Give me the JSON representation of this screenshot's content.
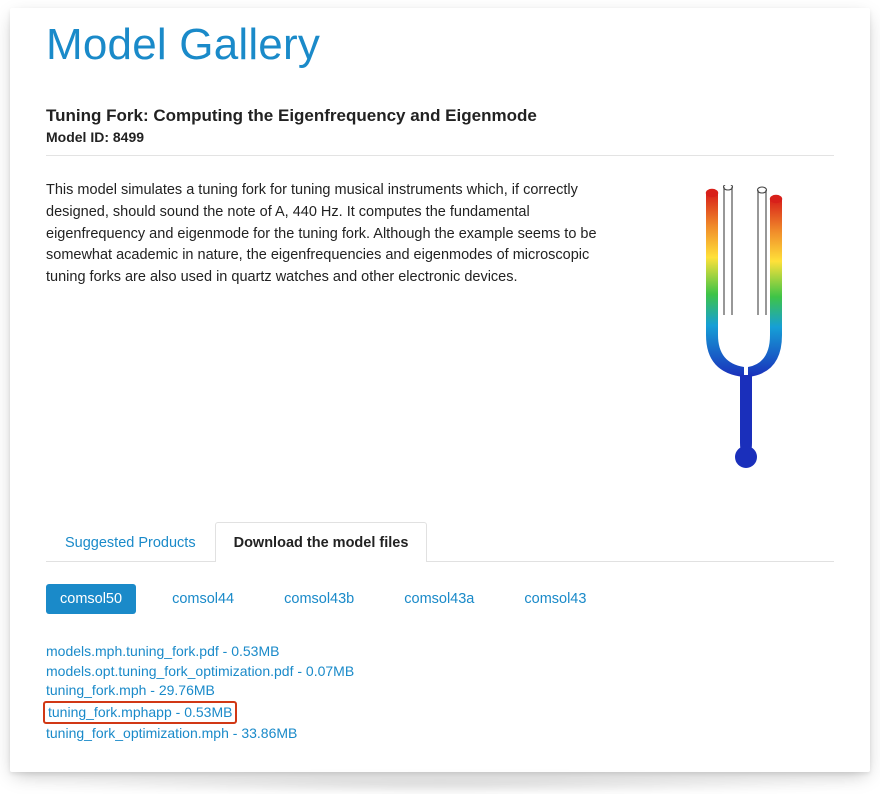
{
  "header": {
    "title": "Model Gallery"
  },
  "model": {
    "title": "Tuning Fork: Computing the Eigenfrequency and Eigenmode",
    "id_label": "Model ID: 8499",
    "description": "This model simulates a tuning fork for tuning musical instruments which, if correctly designed, should sound the note of A, 440 Hz. It computes the fundamental eigenfrequency and eigenmode for the tuning fork. Although the example seems to be somewhat academic in nature, the eigenfrequencies and eigenmodes of microscopic tuning forks are also used in quartz watches and other electronic devices."
  },
  "tabs": {
    "suggested": "Suggested Products",
    "download": "Download the model files",
    "active": "download"
  },
  "versions": {
    "items": [
      "comsol50",
      "comsol44",
      "comsol43b",
      "comsol43a",
      "comsol43"
    ],
    "active": "comsol50"
  },
  "files": [
    {
      "label": "models.mph.tuning_fork.pdf - 0.53MB",
      "highlight": false
    },
    {
      "label": "models.opt.tuning_fork_optimization.pdf - 0.07MB",
      "highlight": false
    },
    {
      "label": "tuning_fork.mph - 29.76MB",
      "highlight": false
    },
    {
      "label": "tuning_fork.mphapp - 0.53MB",
      "highlight": true
    },
    {
      "label": "tuning_fork_optimization.mph - 33.86MB",
      "highlight": false
    }
  ]
}
